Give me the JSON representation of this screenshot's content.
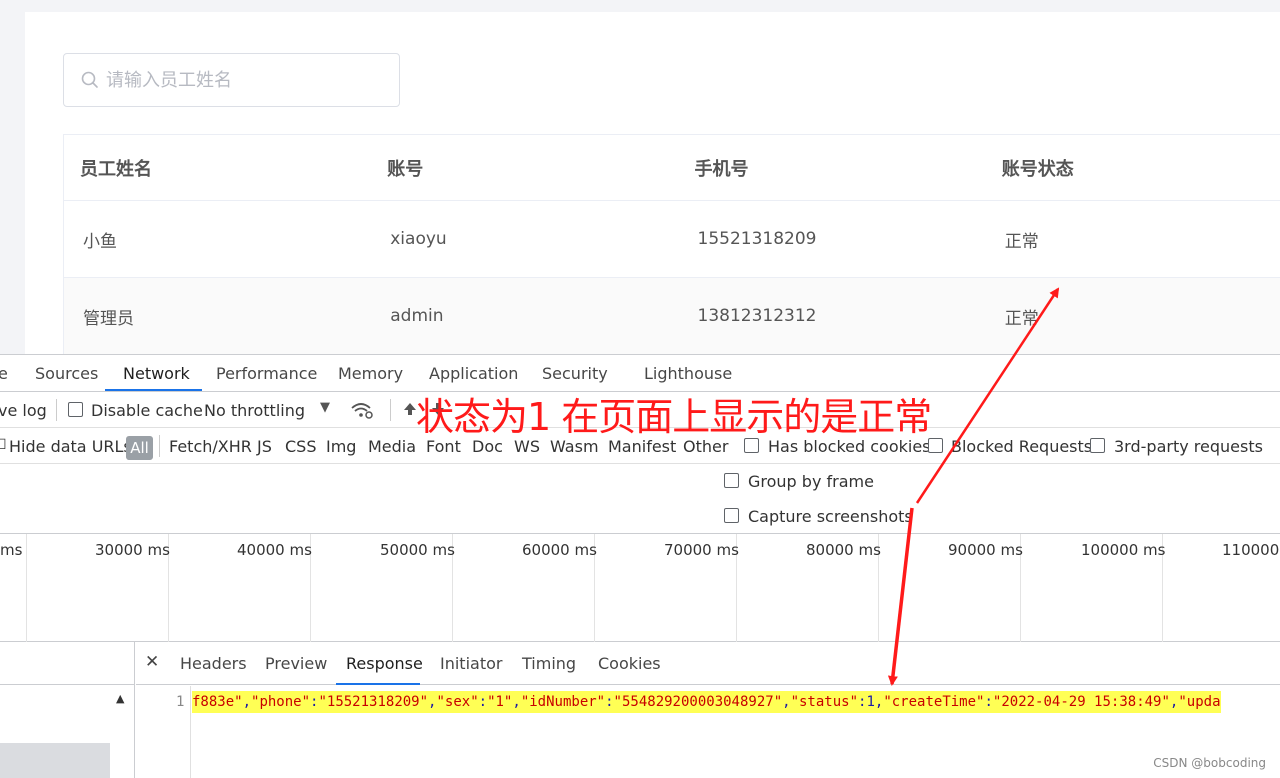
{
  "search": {
    "placeholder": "请输入员工姓名",
    "value": ""
  },
  "table": {
    "headers": [
      "员工姓名",
      "账号",
      "手机号",
      "账号状态"
    ],
    "rows": [
      [
        "小鱼",
        "xiaoyu",
        "15521318209",
        "正常"
      ],
      [
        "管理员",
        "admin",
        "13812312312",
        "正常"
      ]
    ]
  },
  "devtools": {
    "tabs": [
      "e",
      "Sources",
      "Network",
      "Performance",
      "Memory",
      "Application",
      "Security",
      "Lighthouse"
    ],
    "active_tab": "Network",
    "toolbar": {
      "preserve_log": "ve log",
      "disable_cache": "Disable cache",
      "throttling": "No throttling"
    },
    "filter": {
      "hide_data_urls": "Hide data URLs",
      "all": "All",
      "types": [
        "Fetch/XHR",
        "JS",
        "CSS",
        "Img",
        "Media",
        "Font",
        "Doc",
        "WS",
        "Wasm",
        "Manifest",
        "Other"
      ],
      "has_blocked_cookies": "Has blocked cookies",
      "blocked_requests": "Blocked Requests",
      "third_party": "3rd-party requests"
    },
    "options": {
      "group_by_frame": "Group by frame",
      "capture_screenshots": "Capture screenshots"
    },
    "timeline_ticks": [
      "ms",
      "30000 ms",
      "40000 ms",
      "50000 ms",
      "60000 ms",
      "70000 ms",
      "80000 ms",
      "90000 ms",
      "100000 ms",
      "110000"
    ],
    "detail_tabs": [
      "Headers",
      "Preview",
      "Response",
      "Initiator",
      "Timing",
      "Cookies"
    ],
    "active_detail_tab": "Response",
    "response": {
      "line_number": "1",
      "fragment_start": "f883e\"",
      "phone_key": "\"phone\"",
      "phone_val": "\"15521318209\"",
      "sex_key": "\"sex\"",
      "sex_val": "\"1\"",
      "id_key": "\"idNumber\"",
      "id_val": "\"554829200003048927\"",
      "status_key": "\"status\"",
      "status_val": "1",
      "ct_key": "\"createTime\"",
      "ct_val": "\"2022-04-29 15:38:49\"",
      "tail": "\"upda"
    }
  },
  "annotation": {
    "text": "状态为1 在页面上显示的是正常",
    "color": "#ff1a1a"
  },
  "watermark": "CSDN @bobcoding"
}
